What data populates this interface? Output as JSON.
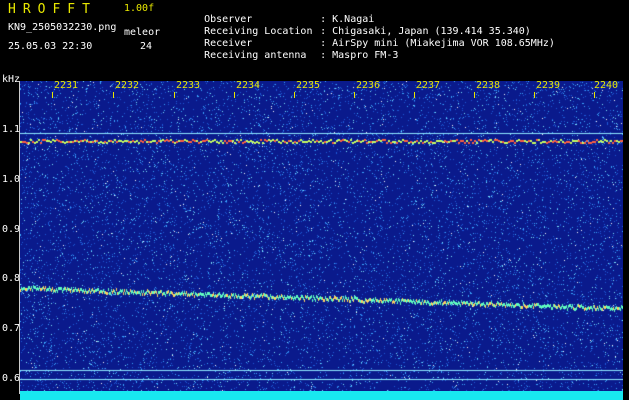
{
  "header": {
    "brand": "HROFFT",
    "version": "1.00f",
    "filename": "KN9_2505032230.png",
    "mode": "meleor",
    "datetime": "25.05.03 22:30",
    "count": "24"
  },
  "info": [
    {
      "key": "Observer",
      "value": ": K.Nagai"
    },
    {
      "key": "Receiving Location",
      "value": ": Chigasaki, Japan (139.414 35.340)"
    },
    {
      "key": "Receiver",
      "value": ": AirSpy mini (Miakejima VOR 108.65MHz)"
    },
    {
      "key": "Receiving antenna",
      "value": ": Maspro FM-3"
    }
  ],
  "yaxis": {
    "unit": "kHz",
    "ticks": [
      "1.1",
      "1.0",
      "0.9",
      "0.8",
      "0.7",
      "0.6"
    ]
  },
  "xaxis": {
    "ticks": [
      "2231",
      "2232",
      "2233",
      "2234",
      "2235",
      "2236",
      "2237",
      "2238",
      "2239",
      "2240"
    ]
  },
  "colors": {
    "background": "#0a1a8c",
    "noise": "#00c8ff",
    "carrier": "#ff6040",
    "trace": "#60ffc0"
  }
}
